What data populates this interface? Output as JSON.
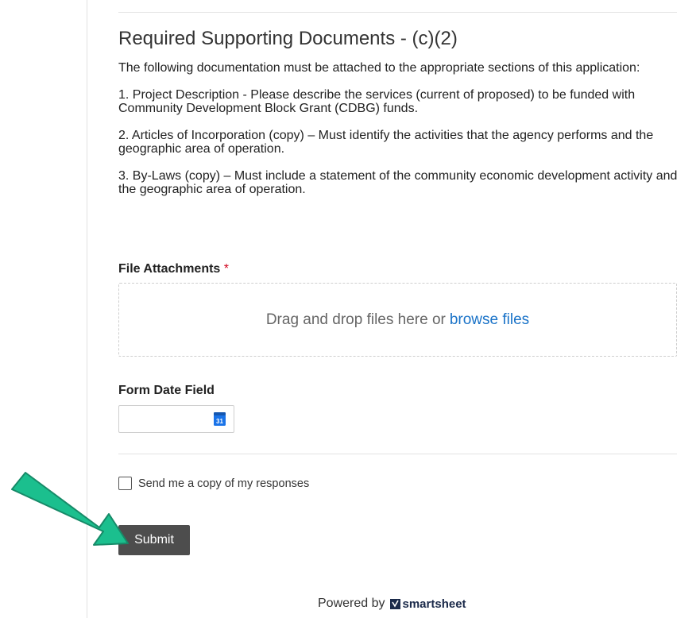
{
  "section": {
    "title": "Required Supporting Documents - (c)(2)",
    "intro": "The following documentation must be attached to the appropriate sections of this application:",
    "items": [
      "1. Project Description - Please describe the services (current of proposed) to be funded with Community Development Block Grant (CDBG) funds.",
      "2. Articles of Incorporation (copy) – Must identify the activities that the agency performs and the geographic area of operation.",
      "3. By-Laws (copy) – Must include a statement of the community economic development activity and the geographic area of operation."
    ]
  },
  "attachments": {
    "label": "File Attachments",
    "required_marker": "*",
    "drop_text": "Drag and drop files here or",
    "browse_text": "browse files"
  },
  "date_field": {
    "label": "Form Date Field",
    "value": "",
    "calendar_day": "31"
  },
  "copy_option": {
    "label": "Send me a copy of my responses",
    "checked": false
  },
  "submit_label": "Submit",
  "footer": {
    "powered_by": "Powered by",
    "brand": "smartsheet"
  },
  "colors": {
    "accent_link": "#1a73c8",
    "submit_bg": "#4d4d4d",
    "arrow": "#1bbf8e",
    "required": "#d0021b"
  }
}
